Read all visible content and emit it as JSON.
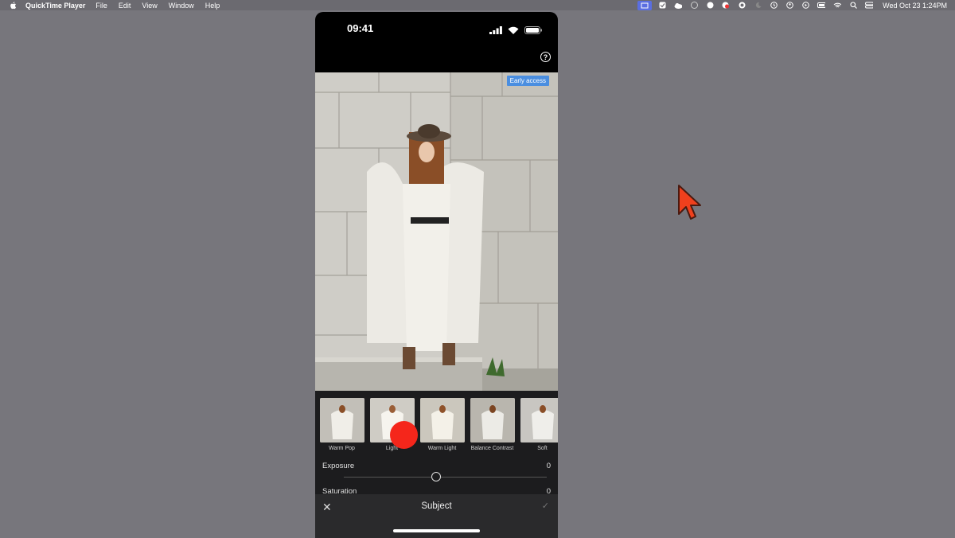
{
  "menubar": {
    "app_name": "QuickTime Player",
    "menus": [
      "File",
      "Edit",
      "View",
      "Window",
      "Help"
    ],
    "clock": "Wed Oct 23  1:24PM"
  },
  "phone": {
    "time": "09:41",
    "badge": "Early access",
    "presets": [
      {
        "label": "Warm Pop"
      },
      {
        "label": "Light"
      },
      {
        "label": "Warm Light"
      },
      {
        "label": "Balance Contrast"
      },
      {
        "label": "Soft"
      }
    ],
    "sliders": [
      {
        "label": "Exposure",
        "value": "0"
      },
      {
        "label": "Saturation",
        "value": "0"
      }
    ],
    "bottom": {
      "title": "Subject",
      "close": "✕",
      "check": "✓"
    }
  }
}
